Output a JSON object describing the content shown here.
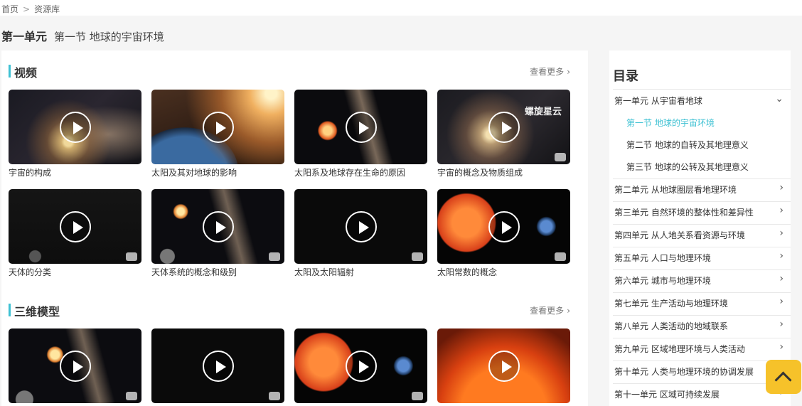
{
  "breadcrumb": {
    "home": "首页",
    "separator": ">",
    "current": "资源库"
  },
  "page": {
    "unit": "第一单元",
    "section": "第一节 地球的宇宙环境"
  },
  "sections": [
    {
      "title": "视频",
      "more": "查看更多",
      "items": [
        {
          "caption": "宇宙的构成",
          "overlay": ""
        },
        {
          "caption": "太阳及其对地球的影响",
          "overlay": ""
        },
        {
          "caption": "太阳系及地球存在生命的原因",
          "overlay": ""
        },
        {
          "caption": "宇宙的概念及物质组成",
          "overlay": "螺旋星云"
        },
        {
          "caption": "天体的分类",
          "overlay": ""
        },
        {
          "caption": "天体系统的概念和级别",
          "overlay": ""
        },
        {
          "caption": "太阳及太阳辐射",
          "overlay": ""
        },
        {
          "caption": "太阳常数的概念",
          "overlay": ""
        }
      ]
    },
    {
      "title": "三维模型",
      "more": "查看更多",
      "items": [
        {
          "caption": ""
        },
        {
          "caption": ""
        },
        {
          "caption": ""
        },
        {
          "caption": ""
        }
      ]
    }
  ],
  "toc": {
    "title": "目录",
    "units": [
      {
        "label": "第一单元 从宇宙看地球",
        "expanded": true
      },
      {
        "label": "第二单元 从地球圈层看地理环境"
      },
      {
        "label": "第三单元 自然环境的整体性和差异性"
      },
      {
        "label": "第四单元 从人地关系看资源与环境"
      },
      {
        "label": "第五单元 人口与地理环境"
      },
      {
        "label": "第六单元 城市与地理环境"
      },
      {
        "label": "第七单元 生产活动与地理环境"
      },
      {
        "label": "第八单元 人类活动的地域联系"
      },
      {
        "label": "第九单元 区域地理环境与人类活动"
      },
      {
        "label": "第十单元 人类与地理环境的协调发展"
      },
      {
        "label": "第十一单元 区域可持续发展"
      }
    ],
    "subsections": [
      {
        "label": "第一节 地球的宇宙环境",
        "active": true
      },
      {
        "label": "第二节 地球的自转及其地理意义"
      },
      {
        "label": "第三节 地球的公转及其地理意义"
      }
    ]
  },
  "icons": {
    "play": "play-icon",
    "chevron": "chevron-right-icon",
    "expand": "chevron-down-icon",
    "top": "back-to-top-icon"
  },
  "colors": {
    "accent": "#3ec1d3",
    "back_top": "#f6c22a"
  }
}
